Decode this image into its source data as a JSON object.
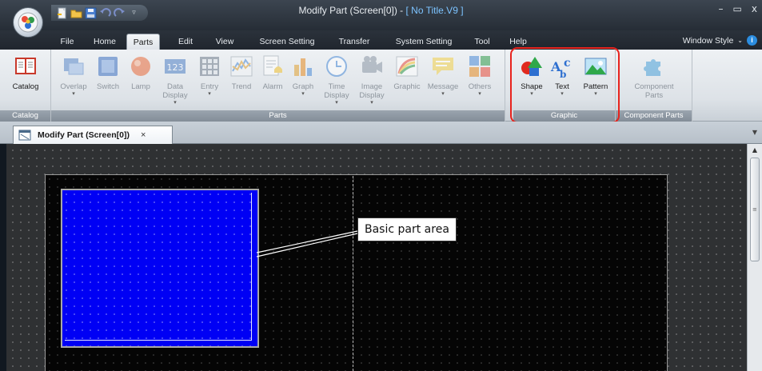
{
  "window": {
    "title": "Modify Part (Screen[0]) - ",
    "title_file": "[ No Title.V9 ]",
    "minimize": "–",
    "maximize": "▭",
    "close": "x"
  },
  "menu_tabs": [
    {
      "label": "File"
    },
    {
      "label": "Home"
    },
    {
      "label": "Parts"
    },
    {
      "label": "Edit"
    },
    {
      "label": "View"
    },
    {
      "label": "Screen Setting"
    },
    {
      "label": "Transfer"
    },
    {
      "label": "System Setting"
    },
    {
      "label": "Tool"
    },
    {
      "label": "Help"
    }
  ],
  "active_tab": "Parts",
  "window_style_label": "Window Style",
  "ribbon": {
    "catalog_group": {
      "label": "Catalog",
      "button": "Catalog"
    },
    "parts_group": {
      "label": "Parts",
      "buttons": [
        {
          "label": "Overlap",
          "icon": "overlap-icon"
        },
        {
          "label": "Switch",
          "icon": "switch-icon"
        },
        {
          "label": "Lamp",
          "icon": "lamp-icon"
        },
        {
          "label": "Data\nDisplay",
          "icon": "data-display-icon"
        },
        {
          "label": "Entry",
          "icon": "entry-icon"
        },
        {
          "label": "Trend",
          "icon": "trend-icon"
        },
        {
          "label": "Alarm",
          "icon": "alarm-icon"
        },
        {
          "label": "Graph",
          "icon": "graph-icon"
        },
        {
          "label": "Time\nDisplay",
          "icon": "time-display-icon"
        },
        {
          "label": "Image\nDisplay",
          "icon": "image-display-icon"
        },
        {
          "label": "Graphic",
          "icon": "graphic-icon"
        },
        {
          "label": "Message",
          "icon": "message-icon"
        },
        {
          "label": "Others",
          "icon": "others-icon"
        }
      ]
    },
    "graphic_group": {
      "label": "Graphic",
      "buttons": [
        {
          "label": "Shape",
          "icon": "shape-icon"
        },
        {
          "label": "Text",
          "icon": "text-icon"
        },
        {
          "label": "Pattern",
          "icon": "pattern-icon"
        }
      ]
    },
    "component_group": {
      "label": "Component Parts",
      "button": "Component\nParts"
    }
  },
  "document_tab": {
    "label": "Modify Part (Screen[0])",
    "close": "×"
  },
  "callout": "Basic part area",
  "colors": {
    "part_area": "#0000f5",
    "highlight": "#e8231d",
    "screen_bg": "#050505"
  }
}
